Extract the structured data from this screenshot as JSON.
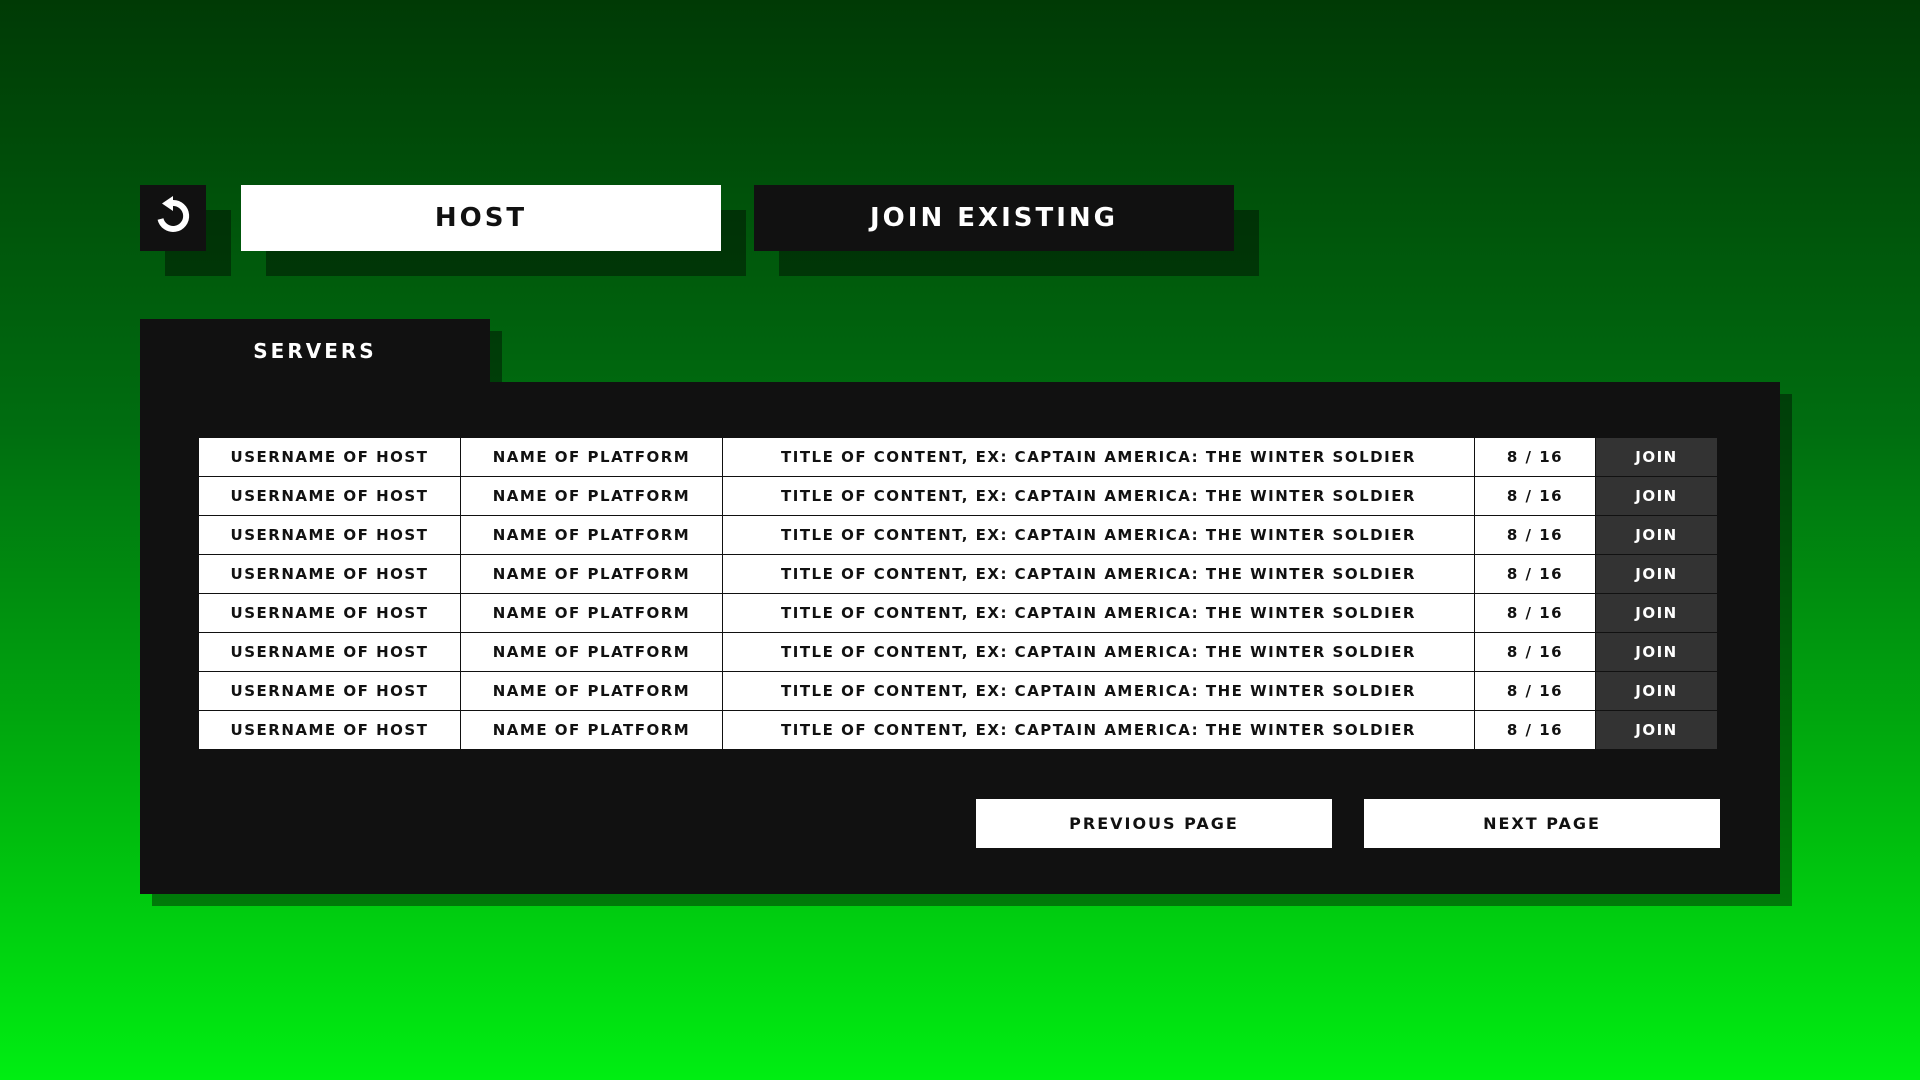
{
  "nav": {
    "back_icon": "undo-arrow-icon",
    "tabs": [
      {
        "label": "HOST",
        "active": true
      },
      {
        "label": "JOIN EXISTING",
        "active": false
      }
    ]
  },
  "servers": {
    "title": "SERVERS",
    "rows": [
      {
        "host": "USERNAME OF HOST",
        "platform": "NAME OF PLATFORM",
        "title": "TITLE OF CONTENT, EX: CAPTAIN AMERICA: THE WINTER SOLDIER",
        "count": "8 / 16",
        "join": "JOIN"
      },
      {
        "host": "USERNAME OF HOST",
        "platform": "NAME OF PLATFORM",
        "title": "TITLE OF CONTENT, EX: CAPTAIN AMERICA: THE WINTER SOLDIER",
        "count": "8 / 16",
        "join": "JOIN"
      },
      {
        "host": "USERNAME OF HOST",
        "platform": "NAME OF PLATFORM",
        "title": "TITLE OF CONTENT, EX: CAPTAIN AMERICA: THE WINTER SOLDIER",
        "count": "8 / 16",
        "join": "JOIN"
      },
      {
        "host": "USERNAME OF HOST",
        "platform": "NAME OF PLATFORM",
        "title": "TITLE OF CONTENT, EX: CAPTAIN AMERICA: THE WINTER SOLDIER",
        "count": "8 / 16",
        "join": "JOIN"
      },
      {
        "host": "USERNAME OF HOST",
        "platform": "NAME OF PLATFORM",
        "title": "TITLE OF CONTENT, EX: CAPTAIN AMERICA: THE WINTER SOLDIER",
        "count": "8 / 16",
        "join": "JOIN"
      },
      {
        "host": "USERNAME OF HOST",
        "platform": "NAME OF PLATFORM",
        "title": "TITLE OF CONTENT, EX: CAPTAIN AMERICA: THE WINTER SOLDIER",
        "count": "8 / 16",
        "join": "JOIN"
      },
      {
        "host": "USERNAME OF HOST",
        "platform": "NAME OF PLATFORM",
        "title": "TITLE OF CONTENT, EX: CAPTAIN AMERICA: THE WINTER SOLDIER",
        "count": "8 / 16",
        "join": "JOIN"
      },
      {
        "host": "USERNAME OF HOST",
        "platform": "NAME OF PLATFORM",
        "title": "TITLE OF CONTENT, EX: CAPTAIN AMERICA: THE WINTER SOLDIER",
        "count": "8 / 16",
        "join": "JOIN"
      }
    ]
  },
  "pagination": {
    "previous_label": "PREVIOUS PAGE",
    "next_label": "NEXT PAGE"
  },
  "colors": {
    "background_top": "#003a05",
    "background_bottom": "#00ee12",
    "panel": "#111111",
    "active_tab": "#ffffff",
    "join_cell": "#333333"
  }
}
